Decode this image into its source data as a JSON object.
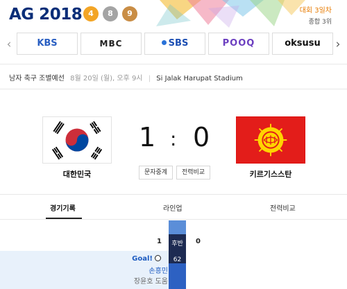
{
  "header": {
    "logo_text": "AG 2018",
    "medals": {
      "gold": "4",
      "silver": "8",
      "bronze": "9"
    },
    "standing_line1": "대회 3일차",
    "standing_line2": "종합 3위"
  },
  "broadcasters": [
    "KBS",
    "MBC",
    "SBS",
    "POOQ",
    "oksusu"
  ],
  "match": {
    "title": "남자 축구 조별예선",
    "datetime": "8월 20일 (월), 오후 9시",
    "venue": "Si Jalak Harupat Stadium"
  },
  "teams": {
    "home": {
      "name": "대한민국",
      "score": "1"
    },
    "away": {
      "name": "키르기스스탄",
      "score": "0"
    },
    "colon": ":"
  },
  "buttons": {
    "text_relay": "문자중계",
    "compare": "전력비교"
  },
  "tabs": [
    "경기기록",
    "라인업",
    "전력비교"
  ],
  "timeline": {
    "period_label": "후반",
    "home_score": "1",
    "away_score": "0",
    "events": [
      {
        "type": "Goal!",
        "minute": "62",
        "player": "손흥민",
        "assist": "장윤호 도움"
      }
    ]
  },
  "colors": {
    "accent_blue": "#2d61c2",
    "dark_navy": "#1d2b52",
    "kyrgyz_red": "#e31d1a",
    "korea_red": "#cd2e3a",
    "korea_blue": "#0047a0"
  }
}
